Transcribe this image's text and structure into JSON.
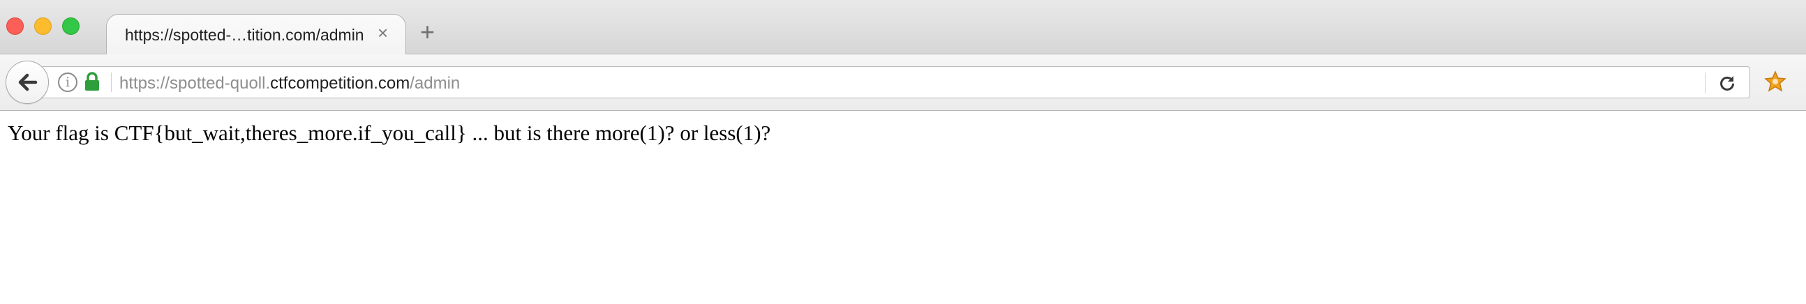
{
  "browser": {
    "tab": {
      "title": "https://spotted-…tition.com/admin",
      "close_glyph": "×"
    },
    "new_tab_glyph": "+",
    "address_bar": {
      "url_prefix": "https://spotted-quoll.",
      "url_domain": "ctfcompetition.com",
      "url_path": "/admin"
    },
    "icons": {
      "back": "back-arrow-icon",
      "info": "info-icon",
      "lock": "lock-icon",
      "reload": "reload-icon",
      "extension": "extension-icon",
      "info_glyph": "i"
    },
    "colors": {
      "close": "#fc5f57",
      "minimize": "#fdbc2e",
      "maximize": "#33c748",
      "lock_green": "#2e9e3c"
    }
  },
  "page": {
    "message": "Your flag is CTF{but_wait,theres_more.if_you_call} ... but is there more(1)? or less(1)?"
  }
}
